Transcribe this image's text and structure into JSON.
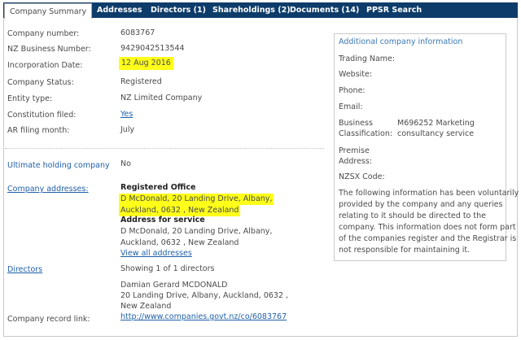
{
  "tabs": [
    {
      "label": "Company Summary"
    },
    {
      "label": "Addresses"
    },
    {
      "label": "Directors (1)"
    },
    {
      "label": "Shareholdings (2)"
    },
    {
      "label": "Documents (14)"
    },
    {
      "label": "PPSR Search"
    }
  ],
  "summary": {
    "company_number_label": "Company number:",
    "company_number": "6083767",
    "nzbn_label": "NZ Business Number:",
    "nzbn": "9429042513544",
    "incorporation_label": "Incorporation Date:",
    "incorporation": "12 Aug 2016",
    "status_label": "Company Status:",
    "status": "Registered",
    "entity_label": "Entity type:",
    "entity": "NZ Limited Company",
    "constitution_label": "Constitution filed:",
    "constitution": "Yes",
    "ar_label": "AR filing month:",
    "ar": "July"
  },
  "holding": {
    "label": "Ultimate holding company",
    "value": "No"
  },
  "addresses": {
    "label": "Company addresses:",
    "registered_title": "Registered Office",
    "registered_line1": "D McDonald, 20 Landing Drive, Albany,",
    "registered_line2": "Auckland, 0632 , New Zealand",
    "service_title": "Address for service",
    "service_line1": "D McDonald, 20 Landing Drive, Albany,",
    "service_line2": "Auckland, 0632 , New Zealand",
    "view_all": "View all addresses"
  },
  "directors": {
    "label": "Directors",
    "showing": "Showing 1 of 1 directors",
    "name": "Damian Gerard MCDONALD",
    "addr_line1": "20 Landing Drive, Albany, Auckland, 0632 ,",
    "addr_line2": "New Zealand"
  },
  "record": {
    "label": "Company record link:",
    "url": "http://www.companies.govt.nz/co/6083767"
  },
  "additional": {
    "title": "Additional company information",
    "trading": "Trading Name:",
    "website": "Website:",
    "phone": "Phone:",
    "email": "Email:",
    "business_label1": "Business",
    "business_label2": "Classification:",
    "business_value1": "M696252 Marketing",
    "business_value2": "consultancy service",
    "premise1": "Premise",
    "premise2": "Address:",
    "nzsx": "NZSX Code:",
    "note_lines": [
      "The following information has been voluntarily",
      "provided by the company and any queries",
      "relating to it should be directed to the",
      "company. This information does not form part",
      "of the companies register and the Registrar is",
      "not responsible for maintaining it."
    ]
  }
}
